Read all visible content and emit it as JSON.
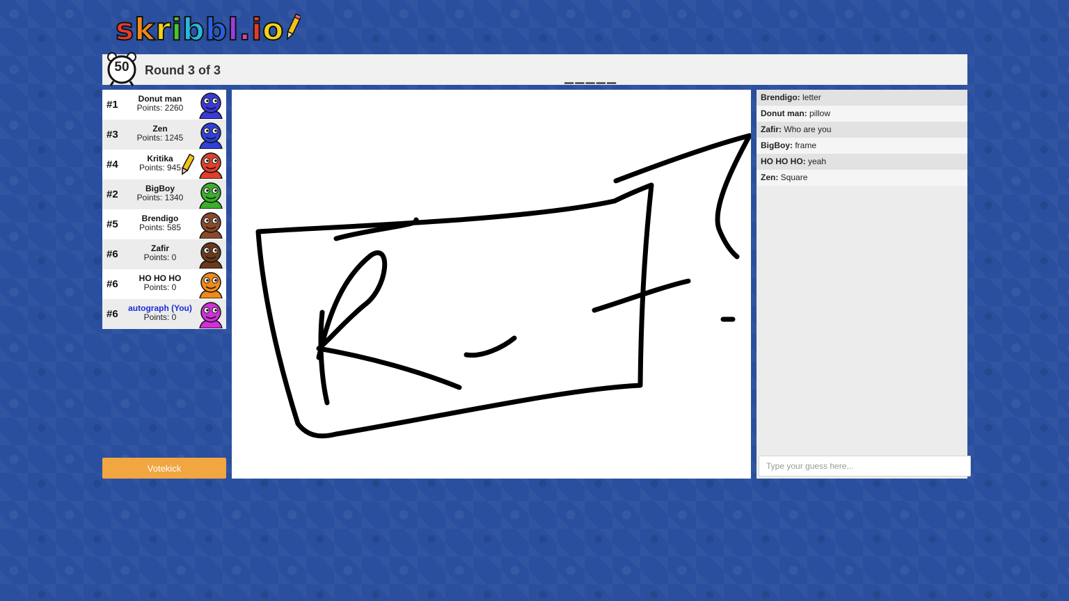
{
  "logo": {
    "letters": [
      {
        "ch": "s",
        "color": "#e83a2a"
      },
      {
        "ch": "k",
        "color": "#f08a1a"
      },
      {
        "ch": "r",
        "color": "#f3d21a"
      },
      {
        "ch": "i",
        "color": "#4cc62c"
      },
      {
        "ch": "b",
        "color": "#26b8e0"
      },
      {
        "ch": "b",
        "color": "#2a5fe0"
      },
      {
        "ch": "l",
        "color": "#9b3de0"
      },
      {
        "ch": ".",
        "color": "#e040b0"
      },
      {
        "ch": "i",
        "color": "#e83a2a"
      },
      {
        "ch": "o",
        "color": "#f3d21a"
      }
    ]
  },
  "header": {
    "timer": "50",
    "round": "Round 3 of 3",
    "word_hint": "_____"
  },
  "players": [
    {
      "rank": "#1",
      "name": "Donut man",
      "points": "Points: 2260",
      "color": "#3a3ad8",
      "drawing": false,
      "you": false
    },
    {
      "rank": "#3",
      "name": "Zen",
      "points": "Points: 1245",
      "color": "#3040d8",
      "drawing": false,
      "you": false
    },
    {
      "rank": "#4",
      "name": "Kritika",
      "points": "Points: 945",
      "color": "#e0402a",
      "drawing": true,
      "you": false
    },
    {
      "rank": "#2",
      "name": "BigBoy",
      "points": "Points: 1340",
      "color": "#3ab02a",
      "drawing": false,
      "you": false
    },
    {
      "rank": "#5",
      "name": "Brendigo",
      "points": "Points: 585",
      "color": "#8a4a2a",
      "drawing": false,
      "you": false
    },
    {
      "rank": "#6",
      "name": "Zafir",
      "points": "Points: 0",
      "color": "#6a3a1a",
      "drawing": false,
      "you": false
    },
    {
      "rank": "#6",
      "name": "HO HO HO",
      "points": "Points: 0",
      "color": "#f08a1a",
      "drawing": false,
      "you": false
    },
    {
      "rank": "#6",
      "name": "autograph (You)",
      "points": "Points: 0",
      "color": "#d030d8",
      "drawing": false,
      "you": true
    }
  ],
  "votekick_label": "Votekick",
  "chat": [
    {
      "user": "Brendigo:",
      "text": " letter"
    },
    {
      "user": "Donut man:",
      "text": " pillow"
    },
    {
      "user": "Zafir:",
      "text": " Who are you"
    },
    {
      "user": "BigBoy:",
      "text": " frame"
    },
    {
      "user": "HO HO HO:",
      "text": " yeah"
    },
    {
      "user": "Zen:",
      "text": " Square"
    }
  ],
  "guess_placeholder": "Type your guess here...",
  "colors": {
    "background": "#2a4f9e",
    "votekick": "#f1a641",
    "you_name": "#1a2bd6"
  }
}
